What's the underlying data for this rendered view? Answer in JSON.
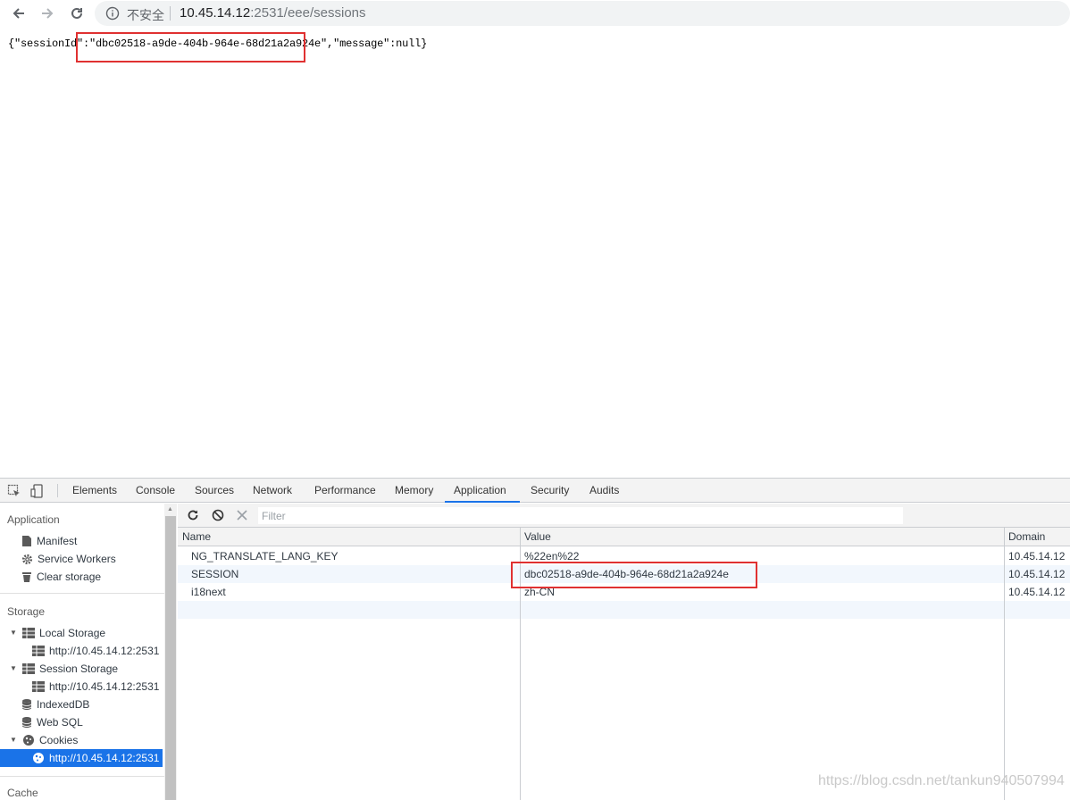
{
  "browser": {
    "security_label": "不安全",
    "url_host": "10.45.14.12",
    "url_rest": ":2531/eee/sessions"
  },
  "page": {
    "json_prefix": "{\"sessionId\":",
    "json_session": "\"dbc02518-a9de-404b-964e-68d21a2a924e\"",
    "json_suffix": ",\"message\":null}"
  },
  "devtools": {
    "tabs": [
      "Elements",
      "Console",
      "Sources",
      "Network",
      "Performance",
      "Memory",
      "Application",
      "Security",
      "Audits"
    ],
    "active_tab": "Application",
    "sidebar": {
      "application_header": "Application",
      "manifest": "Manifest",
      "service_workers": "Service Workers",
      "clear_storage": "Clear storage",
      "storage_header": "Storage",
      "local_storage": "Local Storage",
      "local_storage_origin": "http://10.45.14.12:2531",
      "session_storage": "Session Storage",
      "session_storage_origin": "http://10.45.14.12:2531",
      "indexeddb": "IndexedDB",
      "web_sql": "Web SQL",
      "cookies": "Cookies",
      "cookies_origin": "http://10.45.14.12:2531",
      "cache_header": "Cache"
    },
    "filter_placeholder": "Filter",
    "columns": [
      "Name",
      "Value",
      "Domain"
    ],
    "rows": [
      {
        "name": "NG_TRANSLATE_LANG_KEY",
        "value": "%22en%22",
        "domain": "10.45.14.12"
      },
      {
        "name": "SESSION",
        "value": "dbc02518-a9de-404b-964e-68d21a2a924e",
        "domain": "10.45.14.12"
      },
      {
        "name": "i18next",
        "value": "zh-CN",
        "domain": "10.45.14.12"
      }
    ]
  },
  "watermark": "https://blog.csdn.net/tankun940507994",
  "colors": {
    "accent": "#1a73e8",
    "highlight": "#e03131"
  },
  "icons": [
    "back-arrow-icon",
    "forward-arrow-icon",
    "reload-icon",
    "info-icon",
    "inspect-element-icon",
    "device-toolbar-icon",
    "refresh-icon",
    "clear-icon",
    "delete-icon",
    "document-icon",
    "gear-icon",
    "trash-icon",
    "grid-icon",
    "database-icon",
    "cookie-icon"
  ]
}
